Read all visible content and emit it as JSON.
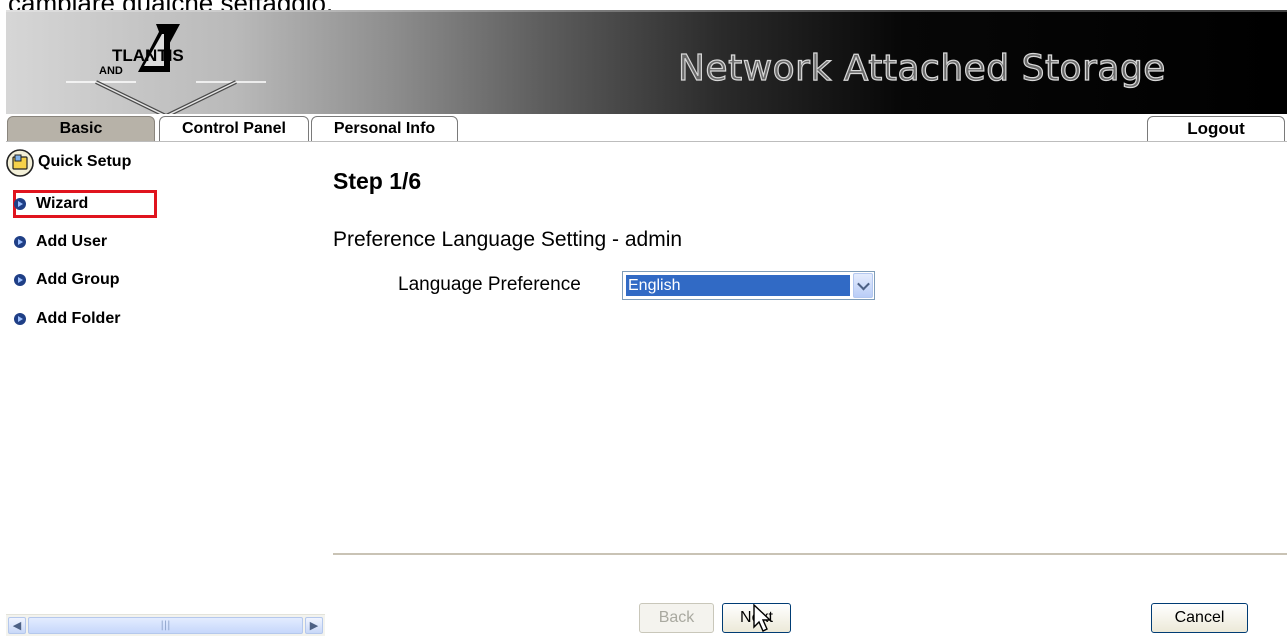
{
  "document": {
    "caption": "cambiare qualche settaggio."
  },
  "header": {
    "logo_text": "TLANTIS",
    "logo_sub": "AND",
    "title": "Network Attached Storage"
  },
  "tabs": [
    {
      "label": "Basic",
      "active": true
    },
    {
      "label": "Control Panel",
      "active": false
    },
    {
      "label": "Personal Info",
      "active": false
    }
  ],
  "logout_label": "Logout",
  "sidebar": {
    "section_title": "Quick Setup",
    "items": [
      {
        "label": "Wizard",
        "selected": true
      },
      {
        "label": "Add User"
      },
      {
        "label": "Add Group"
      },
      {
        "label": "Add Folder"
      }
    ]
  },
  "main": {
    "step_title": "Step 1/6",
    "section_title": "Preference Language Setting - admin",
    "language_label": "Language Preference",
    "language_value": "English"
  },
  "footer": {
    "back_label": "Back",
    "next_label": "Next",
    "cancel_label": "Cancel"
  },
  "colors": {
    "highlight_box": "#e0141e",
    "select_highlight": "#316ac5",
    "active_tab": "#b7b2a8",
    "bullet": "#1f3f86"
  },
  "icons": [
    "folder-setup-icon",
    "arrow-bullet-icon",
    "chevron-down-icon",
    "mouse-cursor-icon",
    "scroll-left-icon",
    "scroll-right-icon"
  ]
}
